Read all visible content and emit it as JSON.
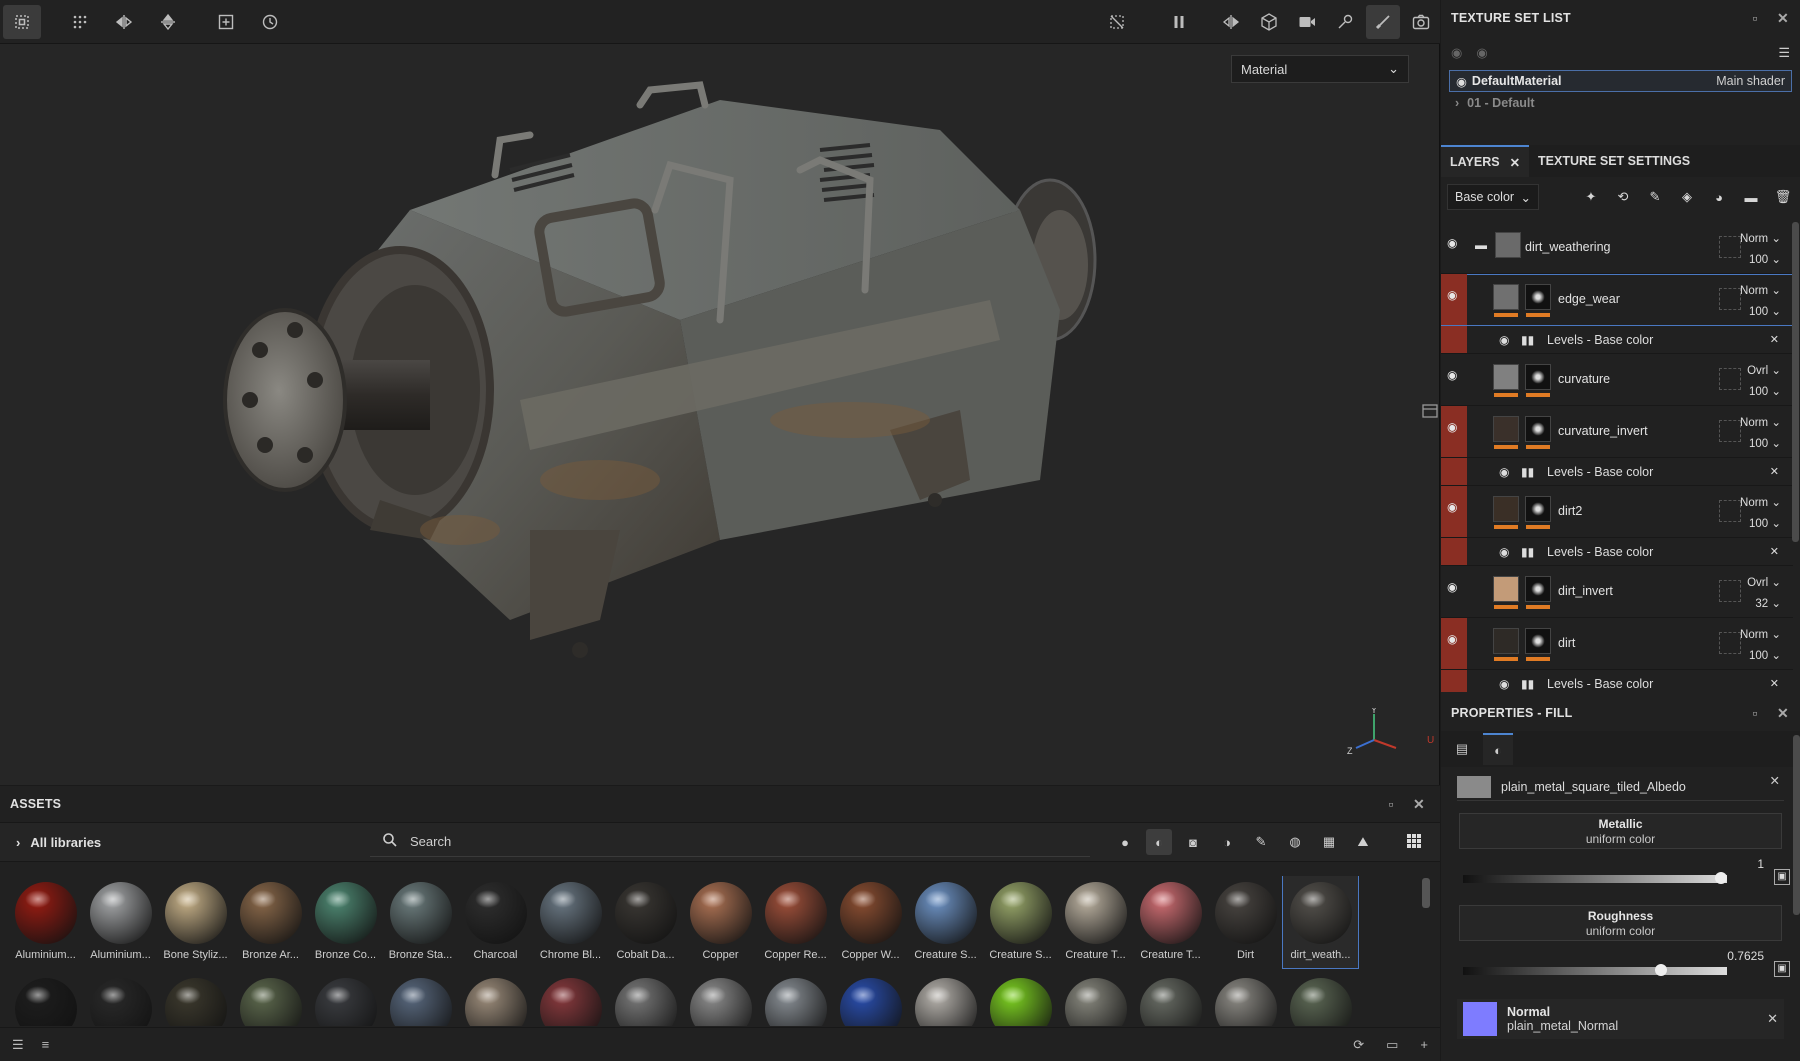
{
  "viewport": {
    "material_mode": "Material",
    "toolbar_left_icons": [
      "select-icon",
      "grid-icon",
      "mirror-x-icon",
      "mirror-y-icon",
      "add-frame-icon",
      "history-icon"
    ],
    "toolbar_right_icons": [
      "hide-icon",
      "pause-icon",
      "symmetry-icon",
      "cube-icon",
      "camera-video-icon",
      "brush-settings-icon",
      "paint-brush-icon",
      "screenshot-icon"
    ],
    "gizmo": {
      "y": "Y",
      "z": "Z",
      "u": "U"
    }
  },
  "assets": {
    "title": "ASSETS",
    "library": "All libraries",
    "search_placeholder": "Search",
    "row1": [
      {
        "label": "Aluminium...",
        "color": "#9a1c12"
      },
      {
        "label": "Aluminium...",
        "color": "#a7a9ab"
      },
      {
        "label": "Bone Styliz...",
        "color": "#c9b38a"
      },
      {
        "label": "Bronze Ar...",
        "color": "#8c6a4b"
      },
      {
        "label": "Bronze Co...",
        "color": "#4f8a74"
      },
      {
        "label": "Bronze Sta...",
        "color": "#6e7f80"
      },
      {
        "label": "Charcoal",
        "color": "#2f2f2f"
      },
      {
        "label": "Chrome Bl...",
        "color": "#6c7a86"
      },
      {
        "label": "Cobalt Da...",
        "color": "#3b3834"
      },
      {
        "label": "Copper",
        "color": "#b07455"
      },
      {
        "label": "Copper Re...",
        "color": "#a2513b"
      },
      {
        "label": "Copper W...",
        "color": "#8d4f32"
      },
      {
        "label": "Creature S...",
        "color": "#6f95c8"
      },
      {
        "label": "Creature S...",
        "color": "#9aa96b"
      },
      {
        "label": "Creature T...",
        "color": "#bdb3a2"
      },
      {
        "label": "Creature T...",
        "color": "#d26f74"
      },
      {
        "label": "Dirt",
        "color": "#4a4642"
      },
      {
        "label": "dirt_weath...",
        "color": "#55524d"
      }
    ],
    "row2": [
      {
        "color": "#1e1e1e"
      },
      {
        "color": "#2a2a2a"
      },
      {
        "color": "#3d3a2e"
      },
      {
        "color": "#5e6a4e"
      },
      {
        "color": "#3c3e42"
      },
      {
        "color": "#5a6a80"
      },
      {
        "color": "#9e8e7c"
      },
      {
        "color": "#8a3a3e"
      },
      {
        "color": "#7a7a7a"
      },
      {
        "color": "#8e8e8e"
      },
      {
        "color": "#8a9096"
      },
      {
        "color": "#2a4fb0"
      },
      {
        "color": "#b8b4ae"
      },
      {
        "color": "#7ed321"
      },
      {
        "color": "#8a8a80"
      },
      {
        "color": "#6a6e66"
      },
      {
        "color": "#8e8c86"
      },
      {
        "color": "#5e6a56"
      }
    ]
  },
  "texture_set_list": {
    "title": "TEXTURE SET LIST",
    "material": "DefaultMaterial",
    "shader": "Main shader",
    "sub": "01 - Default"
  },
  "layers": {
    "tab_layers": "LAYERS",
    "tab_tss": "TEXTURE SET SETTINGS",
    "channel": "Base color",
    "items": [
      {
        "name": "dirt_weathering",
        "blend": "Norm",
        "opacity": "100",
        "red": false,
        "folder": true,
        "thumb": "#6a6a6a"
      },
      {
        "name": "edge_wear",
        "blend": "Norm",
        "opacity": "100",
        "red": true,
        "thumb": "#707070",
        "effect": "Levels - Base color"
      },
      {
        "name": "curvature",
        "blend": "Ovrl",
        "opacity": "100",
        "red": false,
        "thumb": "#808080"
      },
      {
        "name": "curvature_invert",
        "blend": "Norm",
        "opacity": "100",
        "red": true,
        "thumb": "#3a302a",
        "effect": "Levels - Base color"
      },
      {
        "name": "dirt2",
        "blend": "Norm",
        "opacity": "100",
        "red": true,
        "thumb": "#3a2f26",
        "effect": "Levels - Base color"
      },
      {
        "name": "dirt_invert",
        "blend": "Ovrl",
        "opacity": "32",
        "red": false,
        "thumb": "#c39b78"
      },
      {
        "name": "dirt",
        "blend": "Norm",
        "opacity": "100",
        "red": true,
        "thumb": "#2e2a26",
        "effect": "Levels - Base color"
      }
    ]
  },
  "properties": {
    "title": "PROPERTIES - FILL",
    "albedo_map": "plain_metal_square_tiled_Albedo",
    "metallic_title": "Metallic",
    "metallic_sub": "uniform color",
    "metallic_value": "1",
    "metallic_fraction": 1.0,
    "roughness_title": "Roughness",
    "roughness_sub": "uniform color",
    "roughness_value": "0.7625",
    "roughness_fraction": 0.7625,
    "normal_title": "Normal",
    "normal_map": "plain_metal_Normal"
  }
}
